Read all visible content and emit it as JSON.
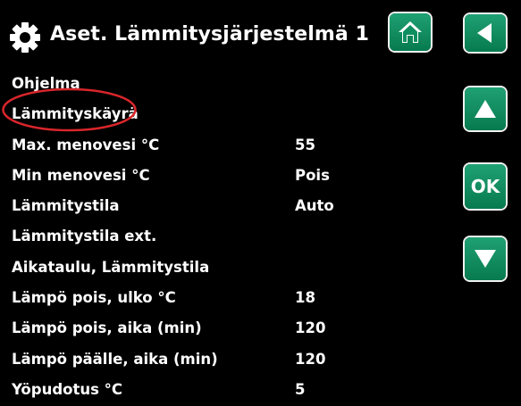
{
  "header": {
    "title": "Aset. Lämmitysjärjestelmä 1",
    "icons": {
      "left": "gear-icon",
      "home": "home-icon",
      "back": "back-arrow-icon"
    }
  },
  "nav": {
    "up_icon": "up-arrow-icon",
    "ok_label": "OK",
    "down_icon": "down-arrow-icon"
  },
  "menu": {
    "items": [
      {
        "label": "Ohjelma",
        "value": ""
      },
      {
        "label": "Lämmityskäyrä",
        "value": ""
      },
      {
        "label": "Max. menovesi °C",
        "value": "55"
      },
      {
        "label": "Min menovesi °C",
        "value": "Pois"
      },
      {
        "label": "Lämmitystila",
        "value": "Auto"
      },
      {
        "label": "Lämmitystila ext.",
        "value": ""
      },
      {
        "label": "Aikataulu, Lämmitystila",
        "value": ""
      },
      {
        "label": "Lämpö pois, ulko °C",
        "value": "18"
      },
      {
        "label": "Lämpö pois, aika (min)",
        "value": "120"
      },
      {
        "label": "Lämpö päälle, aika (min)",
        "value": "120"
      },
      {
        "label": "Yöpudotus °C",
        "value": "5"
      }
    ]
  },
  "colors": {
    "background": "#000000",
    "button_green": "#0f8f60",
    "highlight": "#d9262b",
    "text": "#ffffff"
  }
}
